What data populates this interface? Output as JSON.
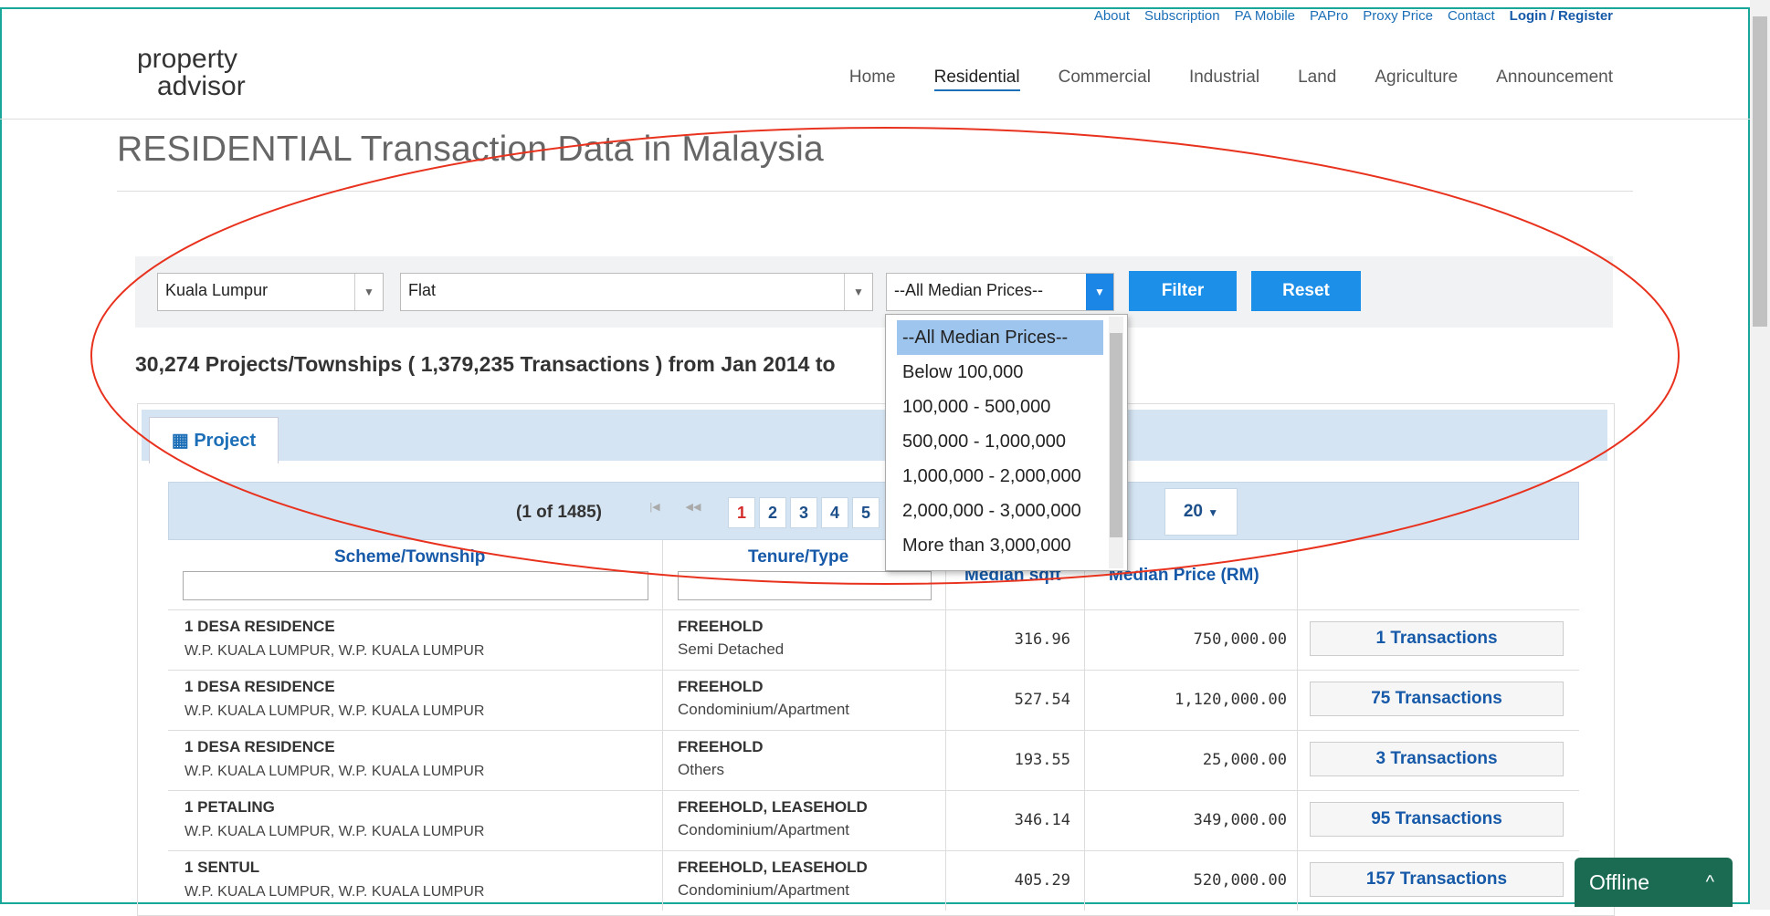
{
  "toplinks": [
    "About",
    "Subscription",
    "PA Mobile",
    "PAPro",
    "Proxy Price",
    "Contact",
    "Login / Register"
  ],
  "logo": {
    "line1": "property",
    "line2": "advisor"
  },
  "nav": [
    "Home",
    "Residential",
    "Commercial",
    "Industrial",
    "Land",
    "Agriculture",
    "Announcement"
  ],
  "page_title": "RESIDENTIAL Transaction Data in Malaysia",
  "filters": {
    "state": "Kuala Lumpur",
    "property_type": "Flat",
    "median_price": "--All Median Prices--",
    "filter_label": "Filter",
    "reset_label": "Reset"
  },
  "summary": "30,274 Projects/Townships ( 1,379,235 Transactions ) from Jan 2014 to",
  "tab_label": "Project",
  "pager": {
    "info": "(1 of 1485)",
    "first": "|◀",
    "prev": "◀◀",
    "pages": [
      "1",
      "2",
      "3",
      "4",
      "5"
    ],
    "per_page": "20"
  },
  "columns": {
    "scheme": "Scheme/Township",
    "tenure": "Tenure/Type",
    "sqft": "Median sqft",
    "price": "Median Price (RM)"
  },
  "rows": [
    {
      "name": "1 DESA RESIDENCE",
      "loc": "W.P. KUALA LUMPUR, W.P. KUALA LUMPUR",
      "tenure": "FREEHOLD",
      "type": "Semi Detached",
      "sqft": "316.96",
      "price": "750,000.00",
      "tx": "1 Transactions"
    },
    {
      "name": "1 DESA RESIDENCE",
      "loc": "W.P. KUALA LUMPUR, W.P. KUALA LUMPUR",
      "tenure": "FREEHOLD",
      "type": "Condominium/Apartment",
      "sqft": "527.54",
      "price": "1,120,000.00",
      "tx": "75 Transactions"
    },
    {
      "name": "1 DESA RESIDENCE",
      "loc": "W.P. KUALA LUMPUR, W.P. KUALA LUMPUR",
      "tenure": "FREEHOLD",
      "type": "Others",
      "sqft": "193.55",
      "price": "25,000.00",
      "tx": "3 Transactions"
    },
    {
      "name": "1 PETALING",
      "loc": "W.P. KUALA LUMPUR, W.P. KUALA LUMPUR",
      "tenure": "FREEHOLD, LEASEHOLD",
      "type": "Condominium/Apartment",
      "sqft": "346.14",
      "price": "349,000.00",
      "tx": "95 Transactions"
    },
    {
      "name": "1 SENTUL",
      "loc": "W.P. KUALA LUMPUR, W.P. KUALA LUMPUR",
      "tenure": "FREEHOLD, LEASEHOLD",
      "type": "Condominium/Apartment",
      "sqft": "405.29",
      "price": "520,000.00",
      "tx": "157 Transactions"
    }
  ],
  "price_options": [
    "--All Median Prices--",
    "Below 100,000",
    "100,000 - 500,000",
    "500,000 - 1,000,000",
    "1,000,000 - 2,000,000",
    "2,000,000 - 3,000,000",
    "More than 3,000,000"
  ],
  "chat": {
    "label": "Offline",
    "chevron": "^"
  },
  "colors": {
    "accent": "#1c8fe8",
    "annotation": "#e8321e",
    "frame": "#19a79a",
    "chat": "#1b6b52"
  },
  "icons": {
    "tab": "table-icon",
    "dropdown": "caret-down-icon"
  }
}
